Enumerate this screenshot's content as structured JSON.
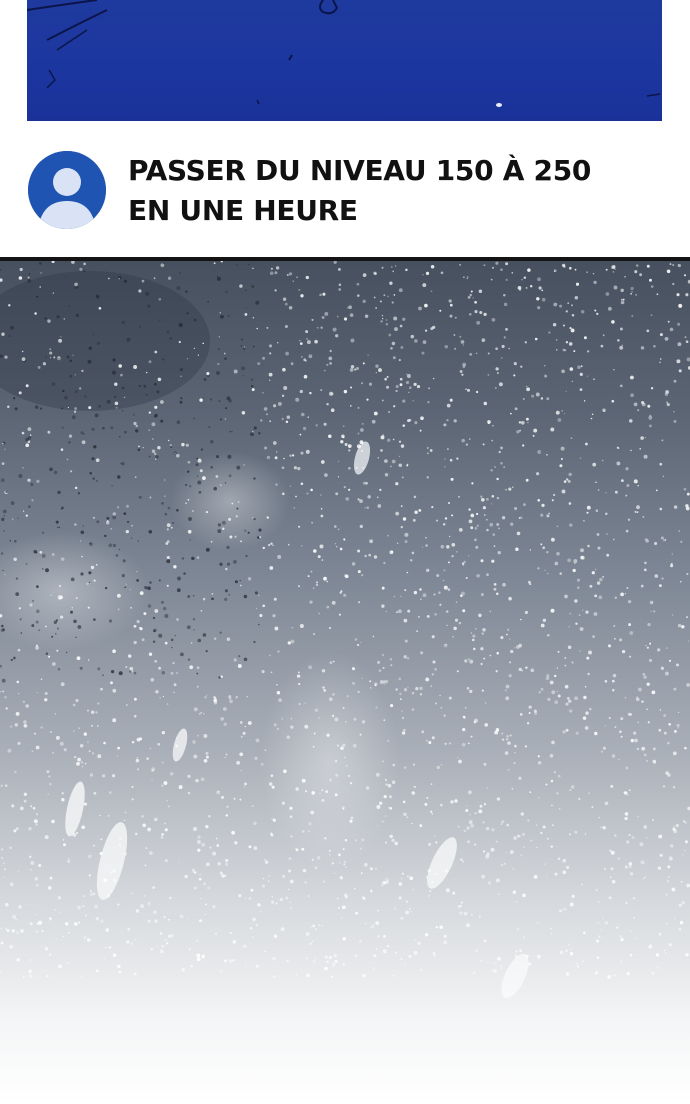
{
  "post": {
    "title_line1": "PASSER DU NIVEAU 150 À 250",
    "title_line2": "EN UNE HEURE"
  },
  "avatar": {
    "icon": "user-avatar-icon",
    "color": "#1f54b3"
  },
  "colors": {
    "top_panel": "#1c36a0",
    "divider": "#141414",
    "text": "#111111"
  }
}
